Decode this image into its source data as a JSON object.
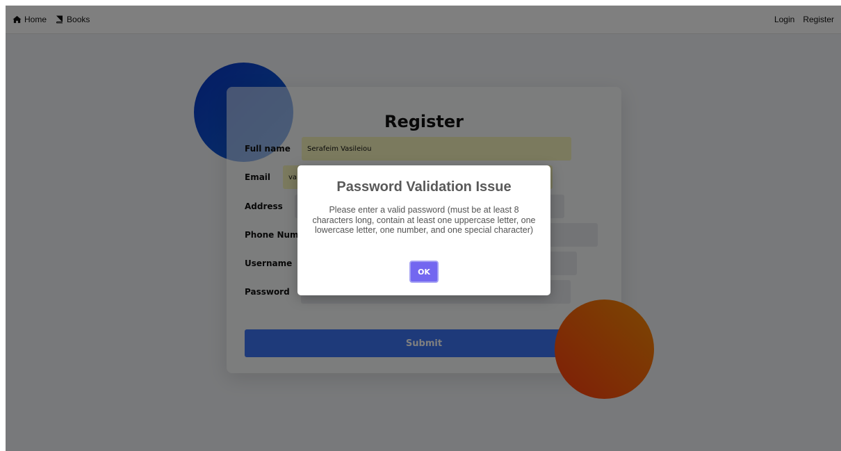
{
  "nav": {
    "home_label": "Home",
    "books_label": "Books",
    "login_label": "Login",
    "register_label": "Register"
  },
  "form": {
    "title": "Register",
    "fields": [
      {
        "label": "Full name",
        "value": "Serafeim Vasileiou",
        "placeholder": ""
      },
      {
        "label": "Email",
        "value": "va",
        "placeholder": ""
      },
      {
        "label": "Address",
        "value": "",
        "placeholder": ""
      },
      {
        "label": "Phone Number",
        "value": "",
        "placeholder": ""
      },
      {
        "label": "Username",
        "value": "",
        "placeholder": ""
      },
      {
        "label": "Password",
        "value": "",
        "placeholder": ""
      }
    ],
    "submit_label": "Submit"
  },
  "modal": {
    "title": "Password Validation Issue",
    "message": "Please enter a valid password (must be at least 8 characters long, contain at least one uppercase letter, one lowercase letter, one number, and one special character)",
    "ok_label": "OK"
  },
  "colors": {
    "accent_blue": "#3c75f5",
    "ok_purple": "#7367f0",
    "autofill_yellow": "#f6f5bd"
  },
  "icons": {
    "home": "home-icon",
    "books": "book-icon"
  }
}
